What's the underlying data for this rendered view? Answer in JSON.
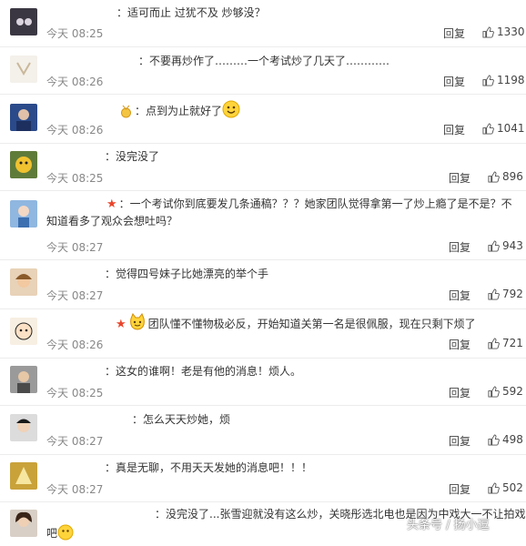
{
  "comments": [
    {
      "text": "：适可而止 过犹不及 炒够没？",
      "time": "今天 08:25",
      "reply": "回复",
      "likes": "1330"
    },
    {
      "text": "：不要再炒作了………一个考试炒了几天了…………",
      "time": "今天 08:26",
      "reply": "回复",
      "likes": "1198"
    },
    {
      "text": "：点到为止就好了",
      "time": "今天 08:26",
      "reply": "回复",
      "likes": "1041"
    },
    {
      "text": "：没完没了",
      "time": "今天 08:25",
      "reply": "回复",
      "likes": "896"
    },
    {
      "text": "：一个考试你到底要发几条通稿？？？她家团队觉得拿第一了炒上瘾了是不是？不知道看多了观众会想吐吗？",
      "time": "今天 08:27",
      "reply": "回复",
      "likes": "943"
    },
    {
      "text": "：觉得四号妹子比她漂亮的举个手",
      "time": "今天 08:27",
      "reply": "回复",
      "likes": "792"
    },
    {
      "text": "团队懂不懂物极必反，开始知道关第一名是很佩服，现在只剩下烦了",
      "time": "今天 08:26",
      "reply": "回复",
      "likes": "721"
    },
    {
      "text": "：这女的谁啊！老是有他的消息！烦人。",
      "time": "今天 08:25",
      "reply": "回复",
      "likes": "592"
    },
    {
      "text": "：怎么天天炒她，烦",
      "time": "今天 08:27",
      "reply": "回复",
      "likes": "498"
    },
    {
      "text": "：真是无聊，不用天天发她的消息吧！！！",
      "time": "今天 08:27",
      "reply": "回复",
      "likes": "502"
    },
    {
      "text": "：没完没了...张雪迎就没有这么炒，关晓彤选北电也是因为中戏大一不让拍戏",
      "text2": "吧"
    }
  ],
  "watermark": "头条号 / 扬小逗",
  "colors": {
    "star": "#e8452b",
    "time": "#888888",
    "divider": "#ececec"
  }
}
